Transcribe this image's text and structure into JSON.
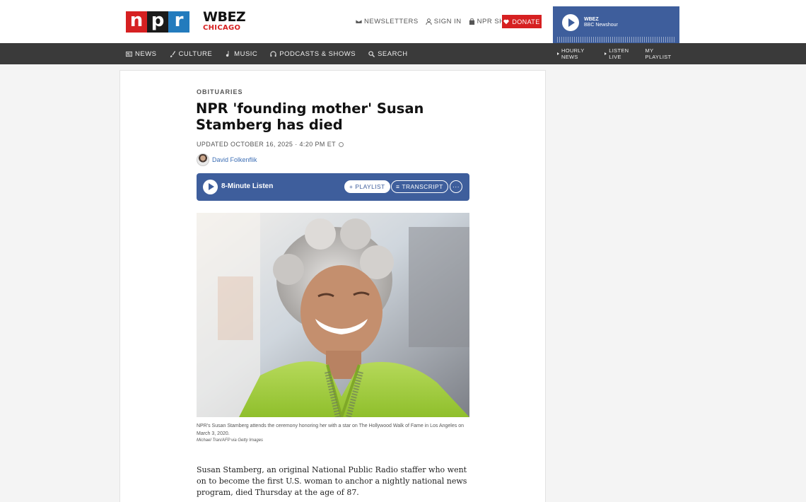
{
  "brand": {
    "npr_letters": [
      "n",
      "p",
      "r"
    ],
    "station_name": "WBEZ",
    "station_city": "CHICAGO"
  },
  "toplinks": {
    "newsletters": "NEWSLETTERS",
    "signin": "SIGN IN",
    "shop": "NPR SHOP",
    "donate": "DONATE"
  },
  "nav": {
    "news": "NEWS",
    "culture": "CULTURE",
    "music": "MUSIC",
    "podcasts": "PODCASTS & SHOWS",
    "search": "SEARCH"
  },
  "player": {
    "station": "WBEZ",
    "show": "BBC Newshour",
    "hourly_news": "HOURLY NEWS",
    "listen_live": "LISTEN LIVE",
    "my_playlist": "MY PLAYLIST"
  },
  "article": {
    "section": "OBITUARIES",
    "headline": "NPR 'founding mother' Susan Stamberg has died",
    "dateline": "UPDATED OCTOBER 16, 2025 · 4:20 PM ET",
    "author": "David Folkenflik",
    "audio_label": "8-Minute Listen",
    "playlist_label": "PLAYLIST",
    "transcript_label": "TRANSCRIPT",
    "more_label": "···",
    "caption": "NPR's Susan Stamberg attends the ceremony honoring her with a star on The Hollywood Walk of Fame in Los Angeles on March 3, 2020.",
    "credit": "Michael Tran/AFP via Getty Images",
    "body": "Susan Stamberg, an original National Public Radio staffer who went on to become the first U.S. woman to anchor a nightly national news program, died Thursday at the age of 87."
  },
  "colors": {
    "npr_red": "#d62021",
    "npr_black": "#1a1a1a",
    "npr_blue": "#237bbd",
    "player_blue": "#3e5e9c",
    "nav_gray": "#3a3a3a"
  }
}
